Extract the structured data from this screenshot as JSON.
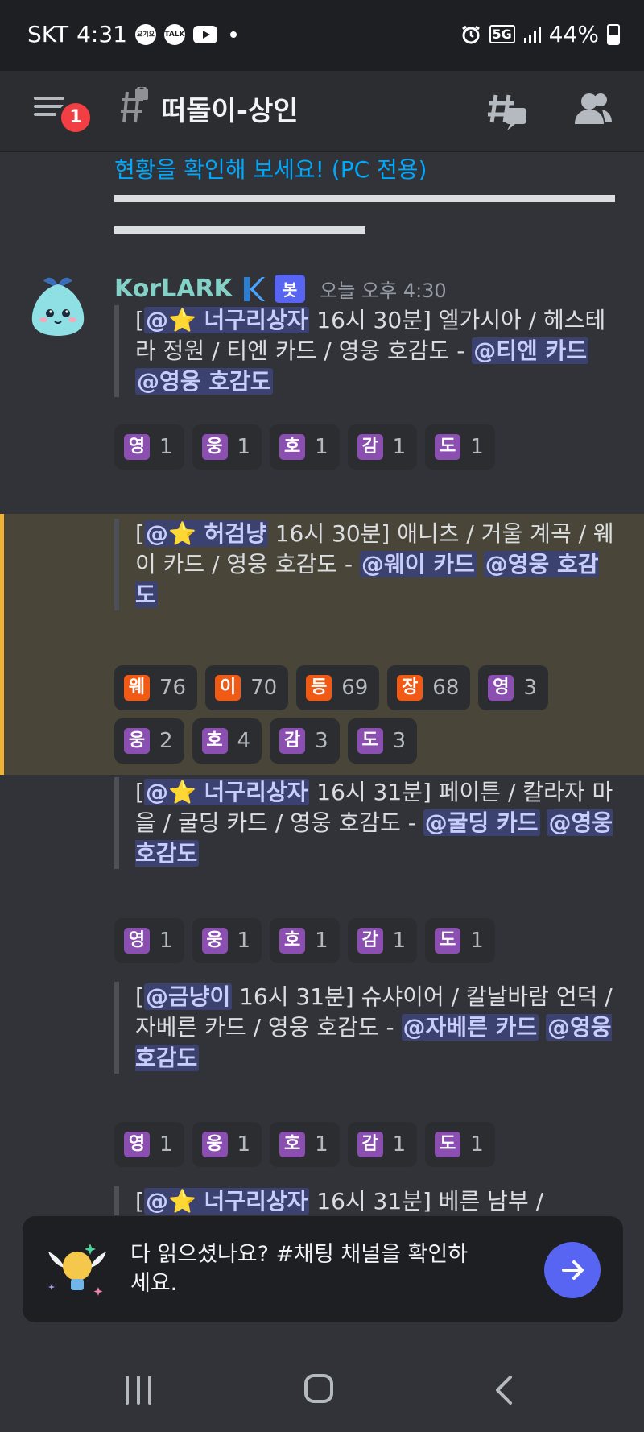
{
  "status_bar": {
    "carrier": "SKT",
    "time": "4:31",
    "app_icon_1": "요기요",
    "app_icon_2": "TALK",
    "network": "5G",
    "battery": "44%"
  },
  "header": {
    "notification_count": "1",
    "channel_name": "떠돌이-상인"
  },
  "intro": {
    "link_text": "현황을 확인해 보세요! (PC 전용)"
  },
  "author": {
    "name": "KorLARK",
    "bot_tag": "봇",
    "timestamp": "오늘 오후 4:30"
  },
  "messages": [
    {
      "open": "[",
      "mention": "@⭐ 너구리상자",
      "text": " 16시 30분] 엘가시아 / 헤스테라 정원 / 티엔 카드 / 영웅 호감도 - ",
      "role_mention_1": "@티엔 카드",
      "role_mention_2": "@영웅 호감도",
      "reactions": [
        {
          "emoji": "영",
          "count": "1",
          "color": "purple"
        },
        {
          "emoji": "웅",
          "count": "1",
          "color": "purple"
        },
        {
          "emoji": "호",
          "count": "1",
          "color": "purple"
        },
        {
          "emoji": "감",
          "count": "1",
          "color": "purple"
        },
        {
          "emoji": "도",
          "count": "1",
          "color": "purple"
        }
      ]
    },
    {
      "open": "[",
      "mention": "@⭐ 허검냥",
      "text": " 16시 30분] 애니츠 / 거울 계곡 / 웨이 카드 / 영웅 호감도 - ",
      "role_mention_1": "@웨이 카드",
      "role_mention_2": "@영웅 호감도",
      "reactions": [
        {
          "emoji": "웨",
          "count": "76",
          "color": "orange"
        },
        {
          "emoji": "이",
          "count": "70",
          "color": "orange"
        },
        {
          "emoji": "등",
          "count": "69",
          "color": "orange"
        },
        {
          "emoji": "장",
          "count": "68",
          "color": "orange"
        },
        {
          "emoji": "영",
          "count": "3",
          "color": "purple"
        },
        {
          "emoji": "웅",
          "count": "2",
          "color": "purple"
        },
        {
          "emoji": "호",
          "count": "4",
          "color": "purple"
        },
        {
          "emoji": "감",
          "count": "3",
          "color": "purple"
        },
        {
          "emoji": "도",
          "count": "3",
          "color": "purple"
        }
      ]
    },
    {
      "open": "[",
      "mention": "@⭐ 너구리상자",
      "text": " 16시 31분] 페이튼 / 칼라자 마을 / 굴딩 카드 / 영웅 호감도 - ",
      "role_mention_1": "@굴딩 카드",
      "role_mention_2": "@영웅 호감도",
      "reactions": [
        {
          "emoji": "영",
          "count": "1",
          "color": "purple"
        },
        {
          "emoji": "웅",
          "count": "1",
          "color": "purple"
        },
        {
          "emoji": "호",
          "count": "1",
          "color": "purple"
        },
        {
          "emoji": "감",
          "count": "1",
          "color": "purple"
        },
        {
          "emoji": "도",
          "count": "1",
          "color": "purple"
        }
      ]
    },
    {
      "open": "[",
      "mention": "@금냥이",
      "text": " 16시 31분] 슈샤이어 / 칼날바람 언덕 / 자베른 카드 / 영웅 호감도 - ",
      "role_mention_1": "@자베른 카드",
      "role_mention_2": "@영웅 호감도",
      "reactions": [
        {
          "emoji": "영",
          "count": "1",
          "color": "purple"
        },
        {
          "emoji": "웅",
          "count": "1",
          "color": "purple"
        },
        {
          "emoji": "호",
          "count": "1",
          "color": "purple"
        },
        {
          "emoji": "감",
          "count": "1",
          "color": "purple"
        },
        {
          "emoji": "도",
          "count": "1",
          "color": "purple"
        }
      ]
    },
    {
      "open": "[",
      "mention": "@⭐ 너구리상자",
      "text": " 16시 31분] 베른 남부 /"
    }
  ],
  "banner": {
    "text": "다 읽으셨나요? #채팅 채널을 확인하세요."
  },
  "colors": {
    "background": "#313338",
    "header": "#2b2d31",
    "accent": "#5865f2",
    "link": "#00a8fc",
    "highlight": "#4a4539",
    "highlight_bar": "#f0b232",
    "badge": "#f23f43"
  }
}
